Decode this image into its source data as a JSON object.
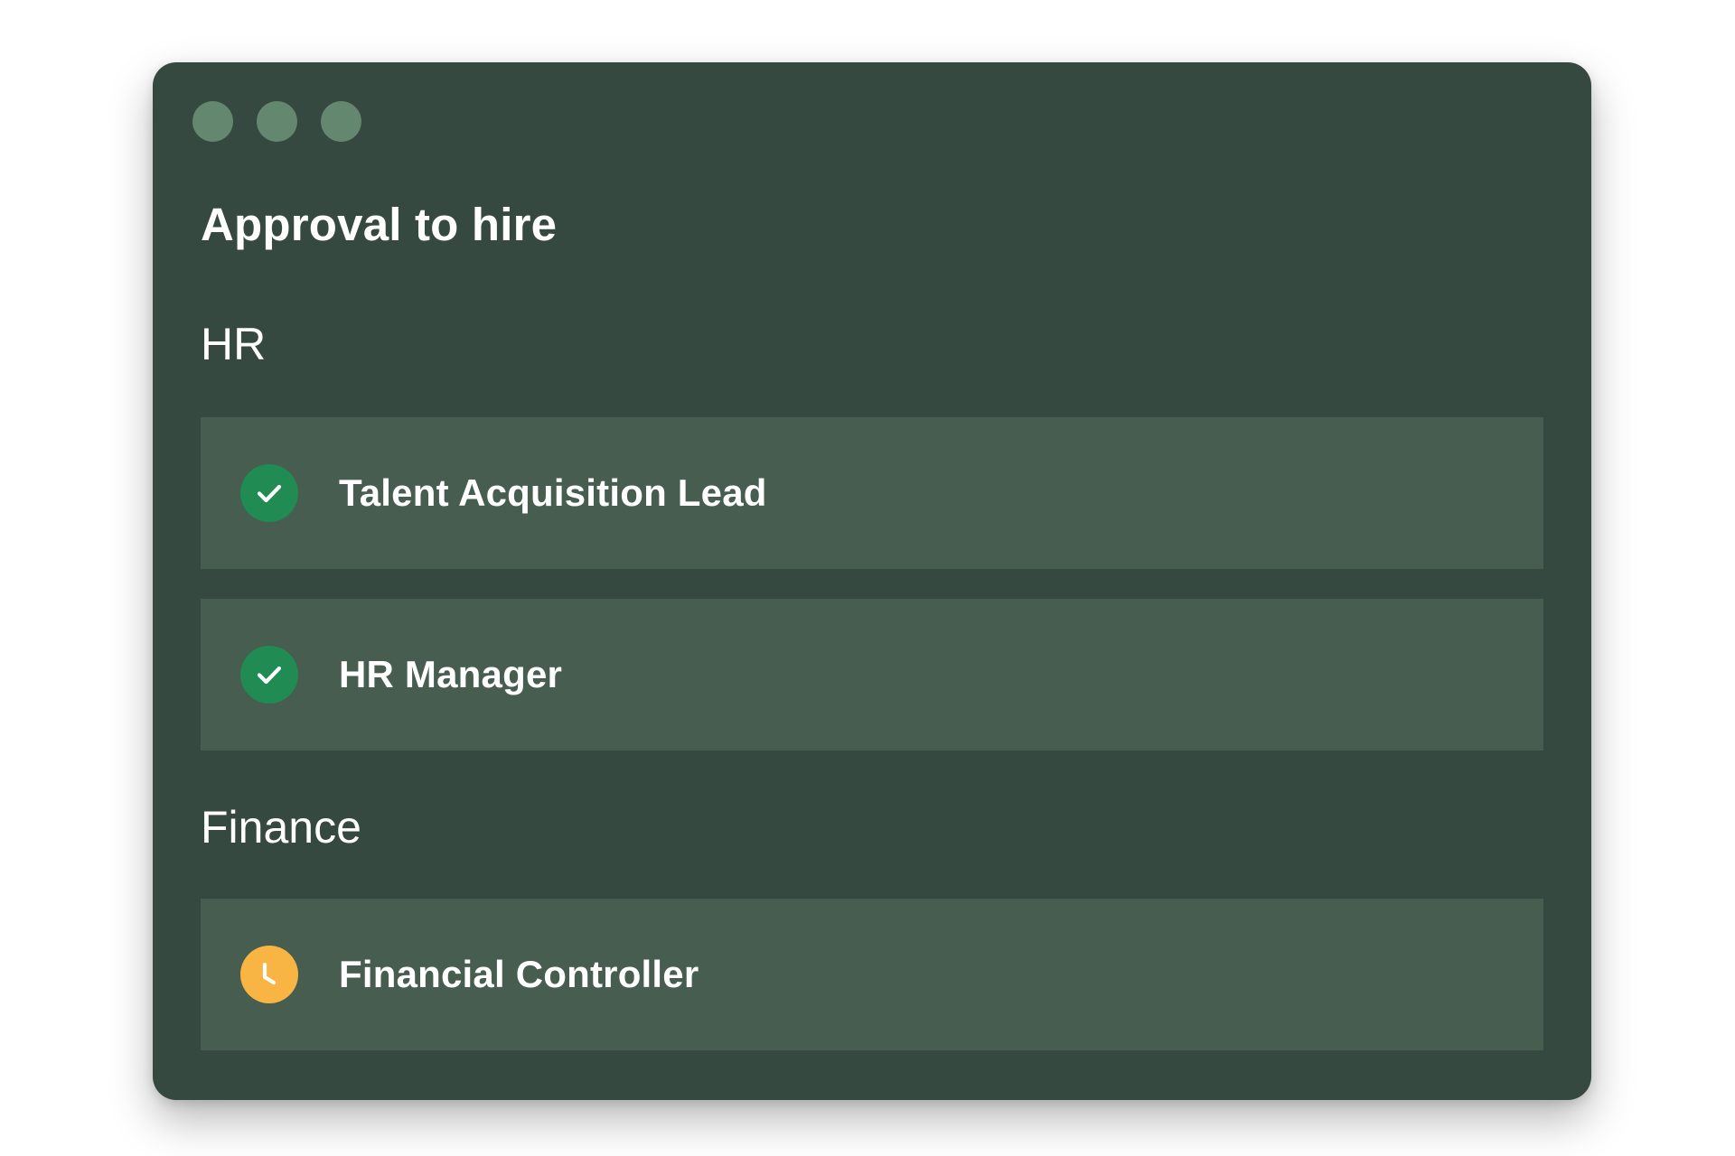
{
  "window": {
    "title": "Approval to hire"
  },
  "sections": [
    {
      "label": "HR",
      "items": [
        {
          "label": "Talent Acquisition Lead",
          "status": "approved",
          "icon": "check-icon"
        },
        {
          "label": "HR Manager",
          "status": "approved",
          "icon": "check-icon"
        }
      ]
    },
    {
      "label": "Finance",
      "items": [
        {
          "label": "Financial Controller",
          "status": "pending",
          "icon": "clock-icon"
        }
      ]
    }
  ],
  "colors": {
    "window_background": "#354940",
    "row_background": "#465d50",
    "traffic_light": "#64876f",
    "approved": "#208b52",
    "pending": "#f9b543",
    "text": "#ffffff"
  }
}
